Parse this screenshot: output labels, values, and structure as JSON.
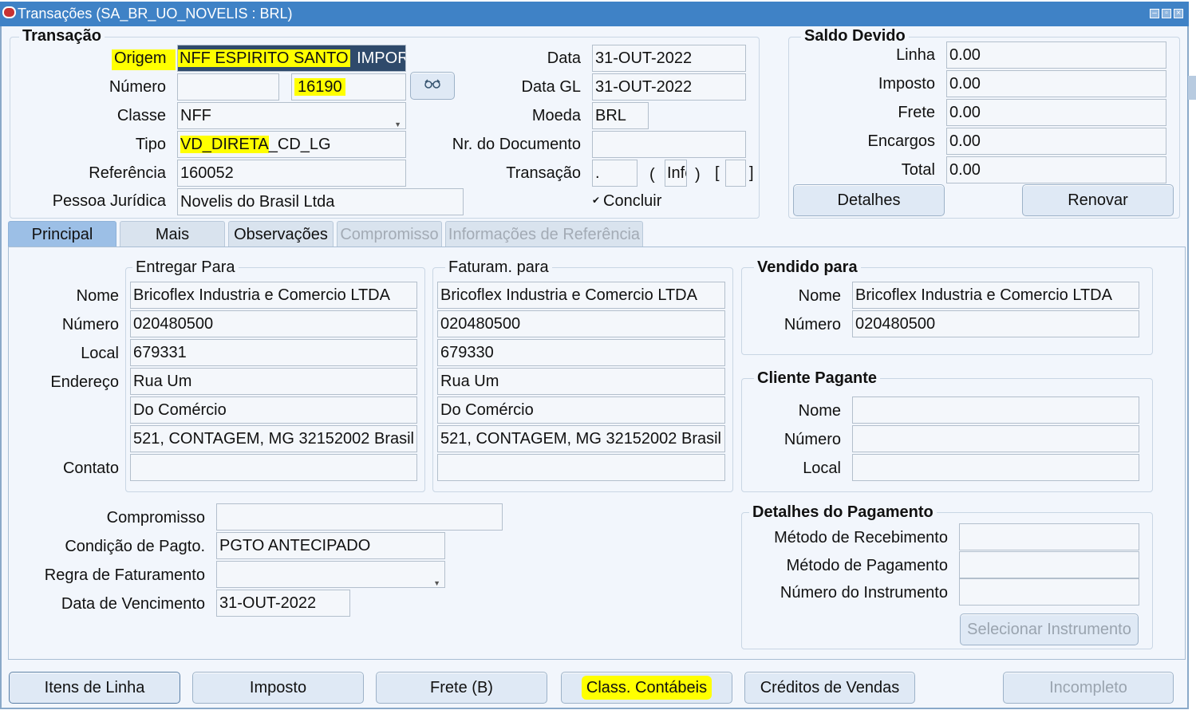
{
  "window": {
    "title": "Transações (SA_BR_UO_NOVELIS : BRL)"
  },
  "transacao": {
    "title": "Transação",
    "origem_label": "Origem",
    "origem_value": "NFF ESPIRITO SANTO",
    "origem_value2": "IMPOR",
    "numero_label": "Número",
    "numero_value": "",
    "numero_value2": "16190",
    "classe_label": "Classe",
    "classe_value": "NFF",
    "tipo_label": "Tipo",
    "tipo_value": "VD_DIRETA",
    "tipo_value2": "_CD_LG",
    "referencia_label": "Referência",
    "referencia_value": "160052",
    "pessoa_label": "Pessoa Jurídica",
    "pessoa_value": "Novelis do Brasil Ltda",
    "data_label": "Data",
    "data_value": "31-OUT-2022",
    "datagl_label": "Data GL",
    "datagl_value": "31-OUT-2022",
    "moeda_label": "Moeda",
    "moeda_value": "BRL",
    "nrdoc_label": "Nr. do Documento",
    "nrdoc_value": "",
    "transacao_label": "Transação",
    "transacao_value": ".",
    "paren_open": "(",
    "info_value": "Info",
    "paren_close": ")",
    "bracket_open": "[",
    "bracket_close": "]",
    "bracket_value": "",
    "concluir_check": "✔",
    "concluir_label": "Concluir"
  },
  "saldo": {
    "title": "Saldo Devido",
    "linha_label": "Linha",
    "linha_value": "0.00",
    "imposto_label": "Imposto",
    "imposto_value": "0.00",
    "frete_label": "Frete",
    "frete_value": "0.00",
    "encargos_label": "Encargos",
    "encargos_value": "0.00",
    "total_label": "Total",
    "total_value": "0.00",
    "detalhes_button": "Detalhes",
    "renovar_button": "Renovar"
  },
  "tabs": [
    {
      "label": "Principal"
    },
    {
      "label": "Mais"
    },
    {
      "label": "Observações"
    },
    {
      "label": "Compromisso"
    },
    {
      "label": "Informações de Referência"
    }
  ],
  "address_labels": {
    "nome": "Nome",
    "numero": "Número",
    "local": "Local",
    "endereco": "Endereço",
    "contato": "Contato"
  },
  "entregar": {
    "title": "Entregar Para",
    "nome": "Bricoflex Industria e Comercio LTDA",
    "numero": "020480500",
    "local": "679331",
    "endereco1": "Rua Um",
    "endereco2": "Do Comércio",
    "endereco3": "521, CONTAGEM, MG 32152002 Brasil",
    "contato": ""
  },
  "faturam": {
    "title": "Faturam. para",
    "nome": "Bricoflex Industria e Comercio LTDA",
    "numero": "020480500",
    "local": "679330",
    "endereco1": "Rua Um",
    "endereco2": "Do Comércio",
    "endereco3": "521, CONTAGEM, MG 32152002 Brasil",
    "contato": ""
  },
  "vendido": {
    "title": "Vendido para",
    "nome_label": "Nome",
    "nome": "Bricoflex Industria e Comercio LTDA",
    "numero_label": "Número",
    "numero": "020480500"
  },
  "pagante": {
    "title": "Cliente Pagante",
    "nome_label": "Nome",
    "nome": "",
    "numero_label": "Número",
    "numero": "",
    "local_label": "Local",
    "local": ""
  },
  "pagamento": {
    "title": "Detalhes do Pagamento",
    "recebimento_label": "Método de Recebimento",
    "recebimento_value": "",
    "pagamento_label": "Método de Pagamento",
    "pagamento_value": "",
    "instrumento_label": "Número do Instrumento",
    "instrumento_value": "",
    "selecionar_button": "Selecionar Instrumento"
  },
  "extra": {
    "compromisso_label": "Compromisso",
    "compromisso_value": "",
    "condicao_label": "Condição de Pagto.",
    "condicao_value": "PGTO ANTECIPADO",
    "regra_label": "Regra de Faturamento",
    "regra_value": "",
    "vencimento_label": "Data de Vencimento",
    "vencimento_value": "31-OUT-2022"
  },
  "bottom_buttons": {
    "itens": "Itens de Linha",
    "imposto": "Imposto",
    "frete": "Frete (B)",
    "class": "Class. Contábeis",
    "creditos": "Créditos de Vendas",
    "incompleto": "Incompleto"
  },
  "colors": {
    "titlebar": "#3f82c6",
    "background": "#f2f6fc",
    "highlight": "#ffff00",
    "selected_tab": "#9cbfe6"
  }
}
